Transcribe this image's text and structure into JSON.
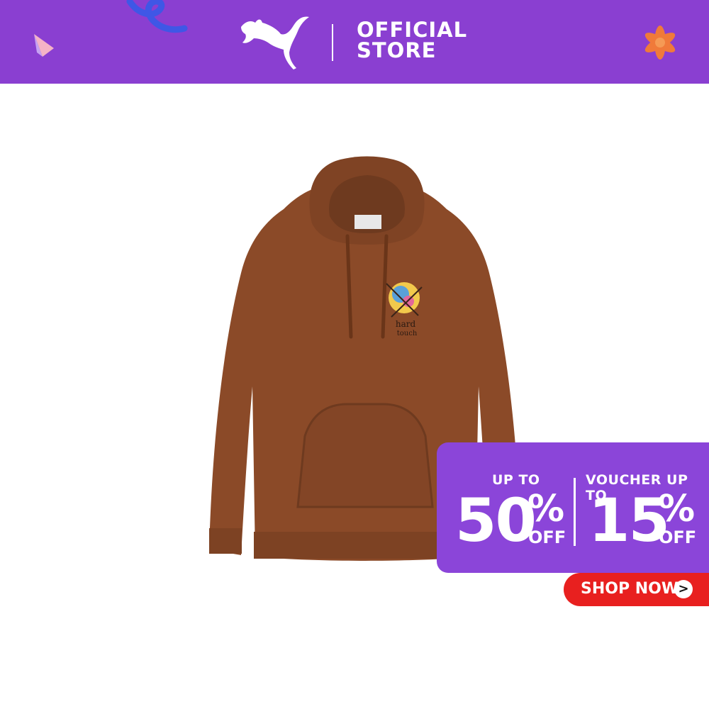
{
  "banner": {
    "brand_logo": "puma-cat-logo",
    "store_line1": "OFFICIAL",
    "store_line2": "STORE",
    "background_color": "#8a3fd1"
  },
  "product": {
    "image": "brown-hoodie",
    "color": "#8b4a28"
  },
  "promo": {
    "left_label": "UP TO",
    "left_value": "50",
    "left_percent": "%",
    "left_off": "OFF",
    "right_label": "VOUCHER UP TO",
    "right_value": "15",
    "right_percent": "%",
    "right_off": "OFF",
    "background_color": "#8b45d9"
  },
  "cta": {
    "label": "SHOP NOW",
    "arrow": ">",
    "color": "#e8201f"
  }
}
